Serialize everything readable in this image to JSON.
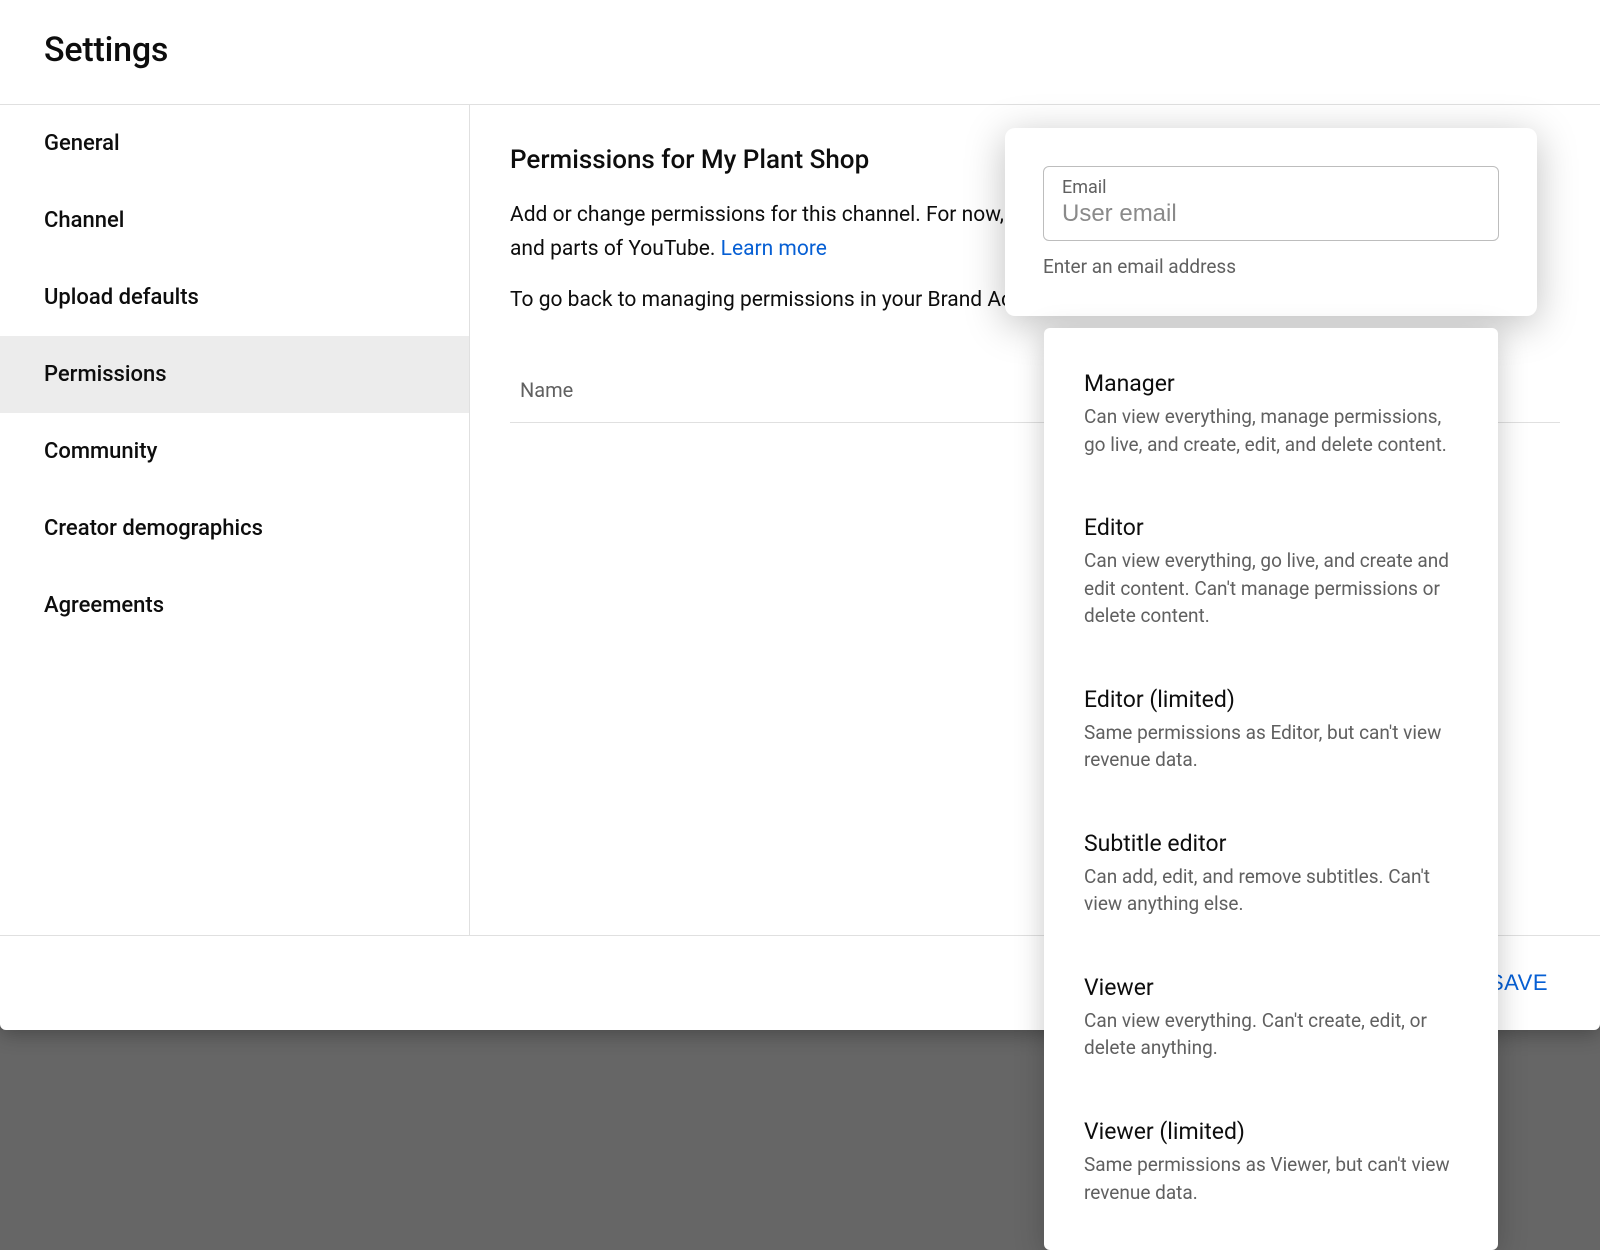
{
  "header": {
    "title": "Settings"
  },
  "sidebar": {
    "items": [
      {
        "label": "General"
      },
      {
        "label": "Channel"
      },
      {
        "label": "Upload defaults"
      },
      {
        "label": "Permissions"
      },
      {
        "label": "Community"
      },
      {
        "label": "Creator demographics"
      },
      {
        "label": "Agreements"
      }
    ],
    "selected_index": 3
  },
  "main": {
    "heading": "Permissions for My Plant Shop",
    "description_part1": "Add or change permissions for this channel. For now, users with permissions can only access certain features and parts of YouTube. ",
    "learn_more": "Learn more",
    "description2": "To go back to managing permissions in your Brand Account,",
    "table": {
      "name_col": "Name"
    }
  },
  "footer": {
    "save_label": "SAVE"
  },
  "popover": {
    "email_label": "Email",
    "email_placeholder": "User email",
    "helper": "Enter an email address"
  },
  "roles": [
    {
      "title": "Manager",
      "desc": "Can view everything, manage permissions, go live, and create, edit, and delete content."
    },
    {
      "title": "Editor",
      "desc": "Can view everything, go live, and create and edit content. Can't manage permissions or delete content."
    },
    {
      "title": "Editor (limited)",
      "desc": "Same permissions as Editor, but can't view revenue data."
    },
    {
      "title": "Subtitle editor",
      "desc": "Can add, edit, and remove subtitles. Can't view anything else."
    },
    {
      "title": "Viewer",
      "desc": "Can view everything. Can't create, edit, or delete anything."
    },
    {
      "title": "Viewer (limited)",
      "desc": "Same permissions as Viewer, but can't view revenue data."
    }
  ]
}
